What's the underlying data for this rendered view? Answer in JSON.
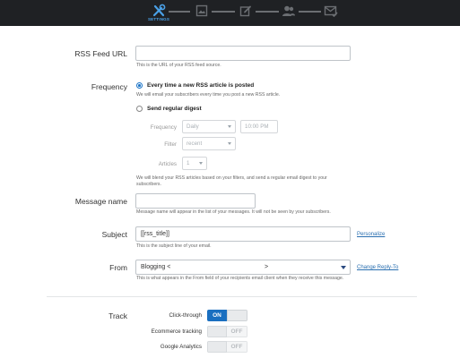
{
  "wizard": {
    "active_step_label": "SETTINGS",
    "steps": [
      "settings-step",
      "template-step",
      "edit-step",
      "recipients-step",
      "send-step"
    ]
  },
  "rss_url": {
    "label": "RSS Feed URL",
    "value": "",
    "help": "This is the URL of your RSS feed source."
  },
  "frequency": {
    "label": "Frequency",
    "option_every": "Every time a new RSS article is posted",
    "option_every_help": "We will email your subscribers every time you post a new RSS article.",
    "option_digest": "Send regular digest",
    "frequency_label": "Frequency",
    "frequency_value": "Daily",
    "time_value": "10:00 PM",
    "filter_label": "Filter",
    "filter_value": "recent",
    "articles_label": "Articles",
    "articles_value": "1",
    "digest_help": "We will blend your RSS articles based on your filters, and send a regular email digest to your subscribers."
  },
  "message_name": {
    "label": "Message name",
    "value": "",
    "help": "Message name will appear in the list of your messages. It will not be seen by your subscribers."
  },
  "subject": {
    "label": "Subject",
    "value": "[[rss_title]]",
    "help": "This is the subject line of your email.",
    "personalize_link": "Personalize"
  },
  "from": {
    "label": "From",
    "value_start": "Blogging <",
    "value_end": ">",
    "help": "This is what appears in the From field of your recipients email client when they receive this message.",
    "change_link": "Change Reply-To"
  },
  "track": {
    "label": "Track",
    "items": [
      {
        "label": "Click-through",
        "state": "ON"
      },
      {
        "label": "Ecommerce tracking",
        "state": "OFF"
      },
      {
        "label": "Google Analytics",
        "state": "OFF"
      }
    ]
  },
  "colors": {
    "topbar": "#1f2124",
    "accent": "#1a73c7",
    "link": "#2a6fb0"
  }
}
